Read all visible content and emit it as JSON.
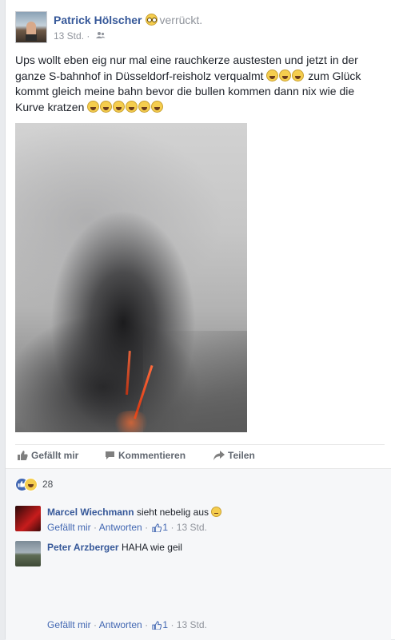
{
  "post": {
    "author": "Patrick Hölscher",
    "feeling": "verrückt.",
    "time": "13 Std.",
    "audience_icon": "friends-icon",
    "text_parts": [
      "Ups wollt eben eig nur mal eine rauchkerze austesten und jetzt in der ganze S-bahnhof in Düsseldorf-reisholz verqualmt ",
      " zum Glück kommt gleich meine bahn bevor die bullen kommen dann nix wie die Kurve kratzen "
    ],
    "photo_icon": "smoke-photo"
  },
  "actions": {
    "like": "Gefällt mir",
    "comment": "Kommentieren",
    "share": "Teilen"
  },
  "reactions": {
    "count": "28",
    "types": [
      "like",
      "haha"
    ]
  },
  "comments": [
    {
      "author": "Marcel Wiechmann",
      "text": "sieht nebelig aus",
      "like_label": "Gefällt mir",
      "reply_label": "Antworten",
      "likes": "1",
      "time": "13 Std."
    },
    {
      "author": "Peter Arzberger",
      "text": "HAHA wie geil",
      "like_label": "Gefällt mir",
      "reply_label": "Antworten",
      "likes": "1",
      "time": "13 Std."
    }
  ],
  "colors": {
    "link": "#365899",
    "accent": "#4267b2",
    "muted": "#90949c",
    "background": "#e9ebee"
  }
}
